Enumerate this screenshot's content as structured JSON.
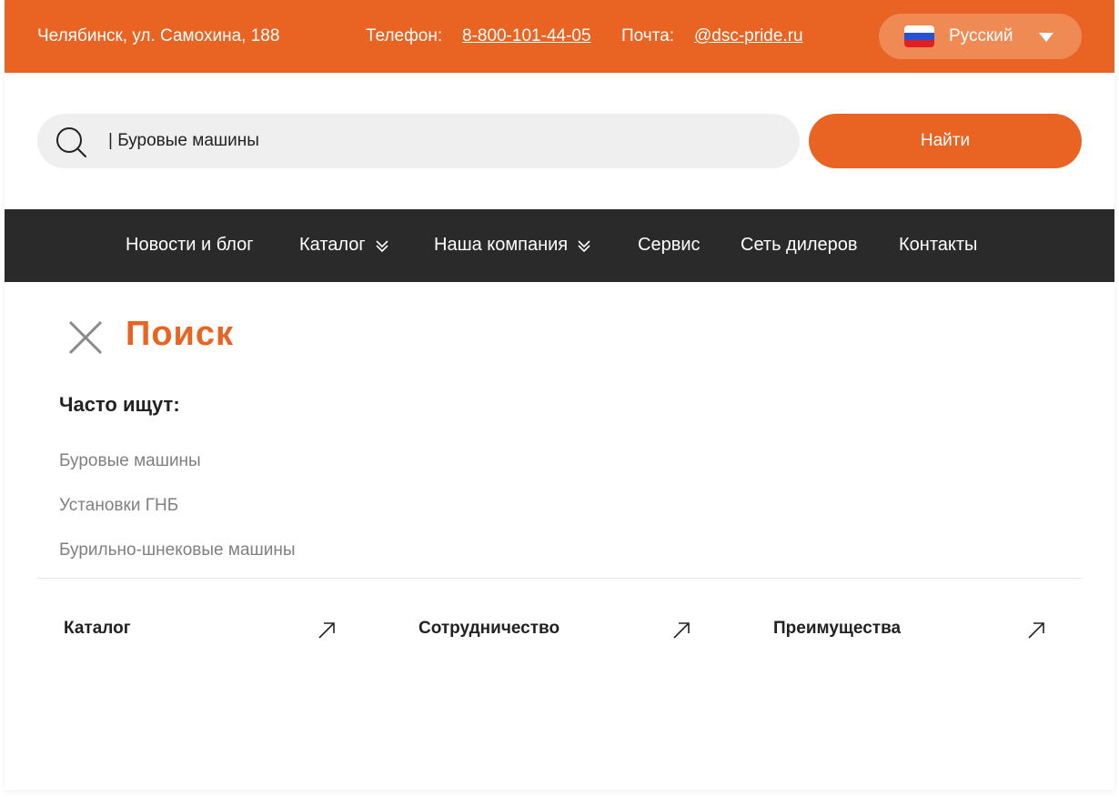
{
  "topbar": {
    "address": "Челябинск, ул. Самохина, 188",
    "phone_label": "Телефон:",
    "phone": "8-800-101-44-05",
    "mail_label": "Почта:",
    "mail": "@dsc-pride.ru",
    "language": "Русский",
    "flag_colors": [
      "#ffffff",
      "#2a4fd0",
      "#e02020"
    ]
  },
  "search": {
    "value": "| Буровые машины",
    "button_label": "Найти"
  },
  "nav": {
    "items": [
      {
        "label": "Новости и блог"
      },
      {
        "label": "Каталог"
      },
      {
        "label": "Наша компания"
      },
      {
        "label": "Сервис"
      },
      {
        "label": "Сеть дилеров"
      },
      {
        "label": "Контакты"
      }
    ]
  },
  "panel": {
    "title": "Поиск",
    "often_label": "Часто ищут:",
    "suggestions": [
      "Буровые машины",
      "Установки ГНБ",
      "Бурильно-шнековые машины"
    ],
    "links": [
      "Каталог",
      "Сотрудничество",
      "Преимущества"
    ]
  },
  "colors": {
    "accent": "#e96322",
    "nav_bg": "#2a2a2a",
    "input_bg": "#efefef",
    "muted_text": "#808080"
  }
}
